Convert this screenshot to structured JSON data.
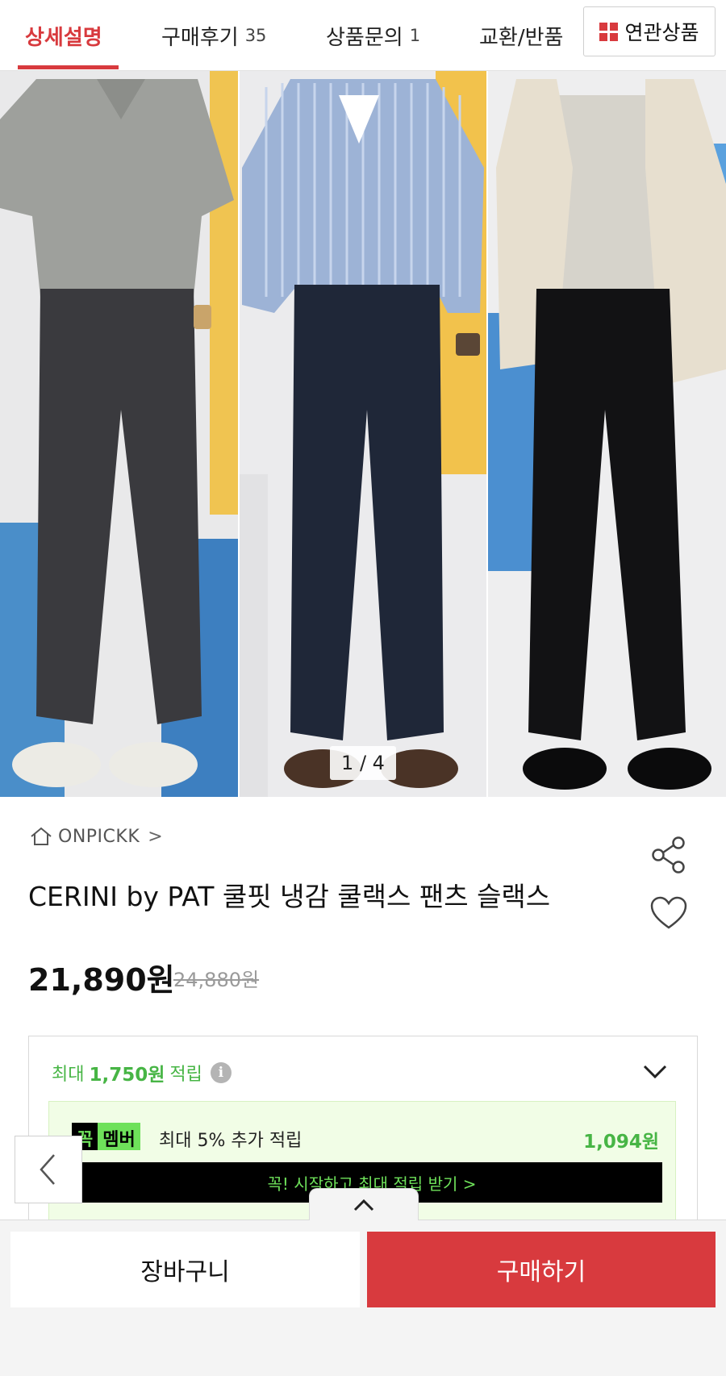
{
  "tabs": [
    {
      "label": "상세설명",
      "count": ""
    },
    {
      "label": "구매후기",
      "count": "35"
    },
    {
      "label": "상품문의",
      "count": "1"
    },
    {
      "label": "교환/반품",
      "count": ""
    }
  ],
  "related_button": {
    "label": "연관상품",
    "icon": "grid-icon"
  },
  "gallery": {
    "page_indicator": "1 / 4"
  },
  "product": {
    "brand": "ONPICKK",
    "title": "CERINI by PAT 쿨핏 냉감 쿨랙스 팬츠 슬랙스",
    "price": "21,890원",
    "original_price": "24,880원"
  },
  "points": {
    "prefix": "최대",
    "amount": "1,750원",
    "suffix": "적립",
    "member": {
      "badge_part1": "꼭",
      "badge_part2": "멤버",
      "text": "최대 5% 추가 적립",
      "amount": "1,094원",
      "cta": "꼭! 시작하고 최대 적립 받기  >"
    }
  },
  "bottom_bar": {
    "cart_label": "장바구니",
    "buy_label": "구매하기"
  },
  "colors": {
    "accent": "#d83a3e",
    "green": "#47b545",
    "neon": "#6ee15a"
  }
}
